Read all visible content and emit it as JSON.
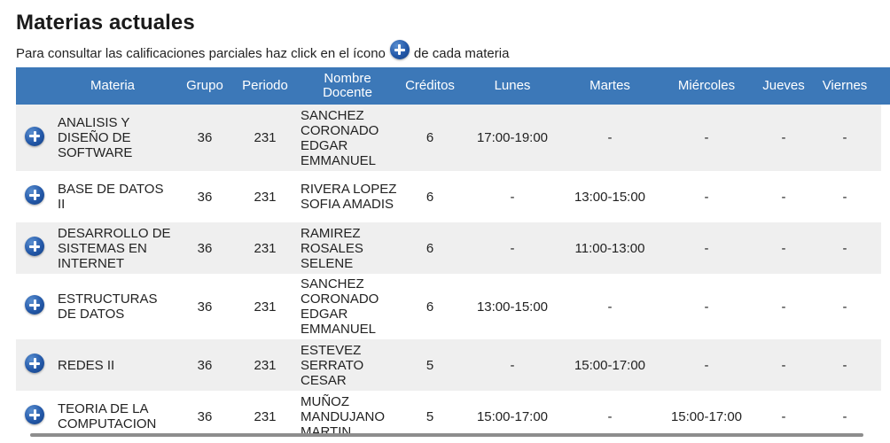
{
  "page": {
    "title": "Materias actuales",
    "subtitle_before": "Para consultar las calificaciones parciales haz click en el ícono",
    "subtitle_after": "de cada materia"
  },
  "table": {
    "headers": {
      "materia": "Materia",
      "grupo": "Grupo",
      "periodo": "Periodo",
      "docente": "Nombre Docente",
      "creditos": "Créditos",
      "lunes": "Lunes",
      "martes": "Martes",
      "miercoles": "Miércoles",
      "jueves": "Jueves",
      "viernes": "Viernes"
    },
    "rows": [
      {
        "materia": "ANALISIS Y DISEÑO DE SOFTWARE",
        "grupo": "36",
        "periodo": "231",
        "docente": "SANCHEZ CORONADO EDGAR EMMANUEL",
        "creditos": "6",
        "lunes": "17:00-19:00",
        "martes": "-",
        "miercoles": "-",
        "jueves": "-",
        "viernes": "-"
      },
      {
        "materia": "BASE DE DATOS II",
        "grupo": "36",
        "periodo": "231",
        "docente": "RIVERA LOPEZ SOFIA AMADIS",
        "creditos": "6",
        "lunes": "-",
        "martes": "13:00-15:00",
        "miercoles": "-",
        "jueves": "-",
        "viernes": "-"
      },
      {
        "materia": "DESARROLLO DE SISTEMAS EN INTERNET",
        "grupo": "36",
        "periodo": "231",
        "docente": "RAMIREZ ROSALES SELENE",
        "creditos": "6",
        "lunes": "-",
        "martes": "11:00-13:00",
        "miercoles": "-",
        "jueves": "-",
        "viernes": "-"
      },
      {
        "materia": "ESTRUCTURAS DE DATOS",
        "grupo": "36",
        "periodo": "231",
        "docente": "SANCHEZ CORONADO EDGAR EMMANUEL",
        "creditos": "6",
        "lunes": "13:00-15:00",
        "martes": "-",
        "miercoles": "-",
        "jueves": "-",
        "viernes": "-"
      },
      {
        "materia": "REDES II",
        "grupo": "36",
        "periodo": "231",
        "docente": "ESTEVEZ SERRATO CESAR",
        "creditos": "5",
        "lunes": "-",
        "martes": "15:00-17:00",
        "miercoles": "-",
        "jueves": "-",
        "viernes": "-"
      },
      {
        "materia": "TEORIA DE LA COMPUTACION",
        "grupo": "36",
        "periodo": "231",
        "docente": "MUÑOZ MANDUJANO MARTIN",
        "creditos": "5",
        "lunes": "15:00-17:00",
        "martes": "-",
        "miercoles": "15:00-17:00",
        "jueves": "-",
        "viernes": "-"
      }
    ]
  },
  "icons": {
    "row_action": "plus-circle-icon"
  },
  "colors": {
    "header_bg": "#3c78b8",
    "row_alt_bg": "#efefef",
    "icon_blue": "#2358a8"
  }
}
